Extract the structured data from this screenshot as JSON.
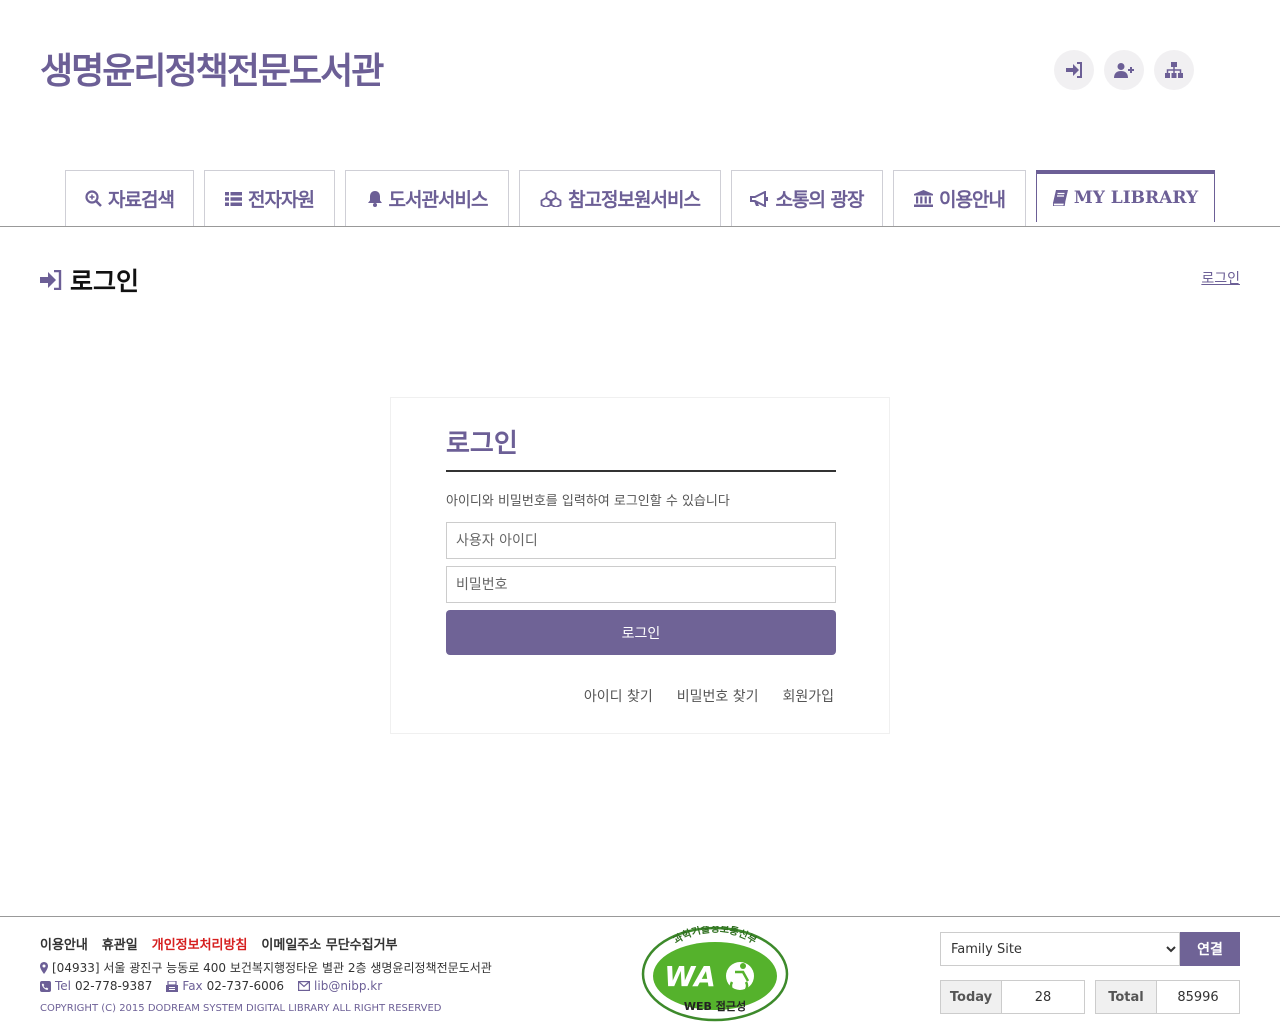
{
  "header": {
    "site_title": "생명윤리정책전문도서관",
    "util_icons": [
      "login-icon",
      "user-plus-icon",
      "sitemap-icon"
    ]
  },
  "nav": {
    "tabs": [
      {
        "label": "자료검색",
        "icon": "search-icon"
      },
      {
        "label": "전자자원",
        "icon": "list-icon"
      },
      {
        "label": "도서관서비스",
        "icon": "bell-icon"
      },
      {
        "label": "참고정보원서비스",
        "icon": "cubes-icon"
      },
      {
        "label": "소통의 광장",
        "icon": "bullhorn-icon"
      },
      {
        "label": "이용안내",
        "icon": "institution-icon"
      },
      {
        "label": "MY LIBRARY",
        "icon": "book-icon",
        "active": true
      }
    ]
  },
  "page": {
    "heading": "로그인",
    "breadcrumb": "로그인"
  },
  "login": {
    "title": "로그인",
    "description": "아이디와 비밀번호를 입력하여 로그인할 수 있습니다",
    "id_placeholder": "사용자 아이디",
    "pw_placeholder": "비밀번호",
    "submit_label": "로그인",
    "links": [
      "아이디 찾기",
      "비밀번호 찾기",
      "회원가입"
    ]
  },
  "footer": {
    "links": [
      "이용안내",
      "휴관일",
      "개인정보처리방침",
      "이메일주소 무단수집거부"
    ],
    "address": "[04933] 서울 광진구 능동로 400 보건복지행정타운 별관 2층 생명윤리정책전문도서관",
    "tel_label": "Tel",
    "tel": "02-778-9387",
    "fax_label": "Fax",
    "fax": "02-737-6006",
    "email": "lib@nibp.kr",
    "copyright": "COPYRIGHT (C) 2015 DODREAM SYSTEM DIGITAL LIBRARY ALL RIGHT RESERVED",
    "wa_mark": {
      "top_text": "과학기술정보통신부",
      "logo_text": "WA",
      "sub_text": "WEB 접근성"
    },
    "family_site": {
      "selected": "Family Site",
      "button": "연결"
    },
    "counter": {
      "today_label": "Today",
      "today": "28",
      "total_label": "Total",
      "total": "85996"
    }
  },
  "colors": {
    "accent": "#6c5f96",
    "button": "#6f6396",
    "red_link": "#d62020"
  }
}
